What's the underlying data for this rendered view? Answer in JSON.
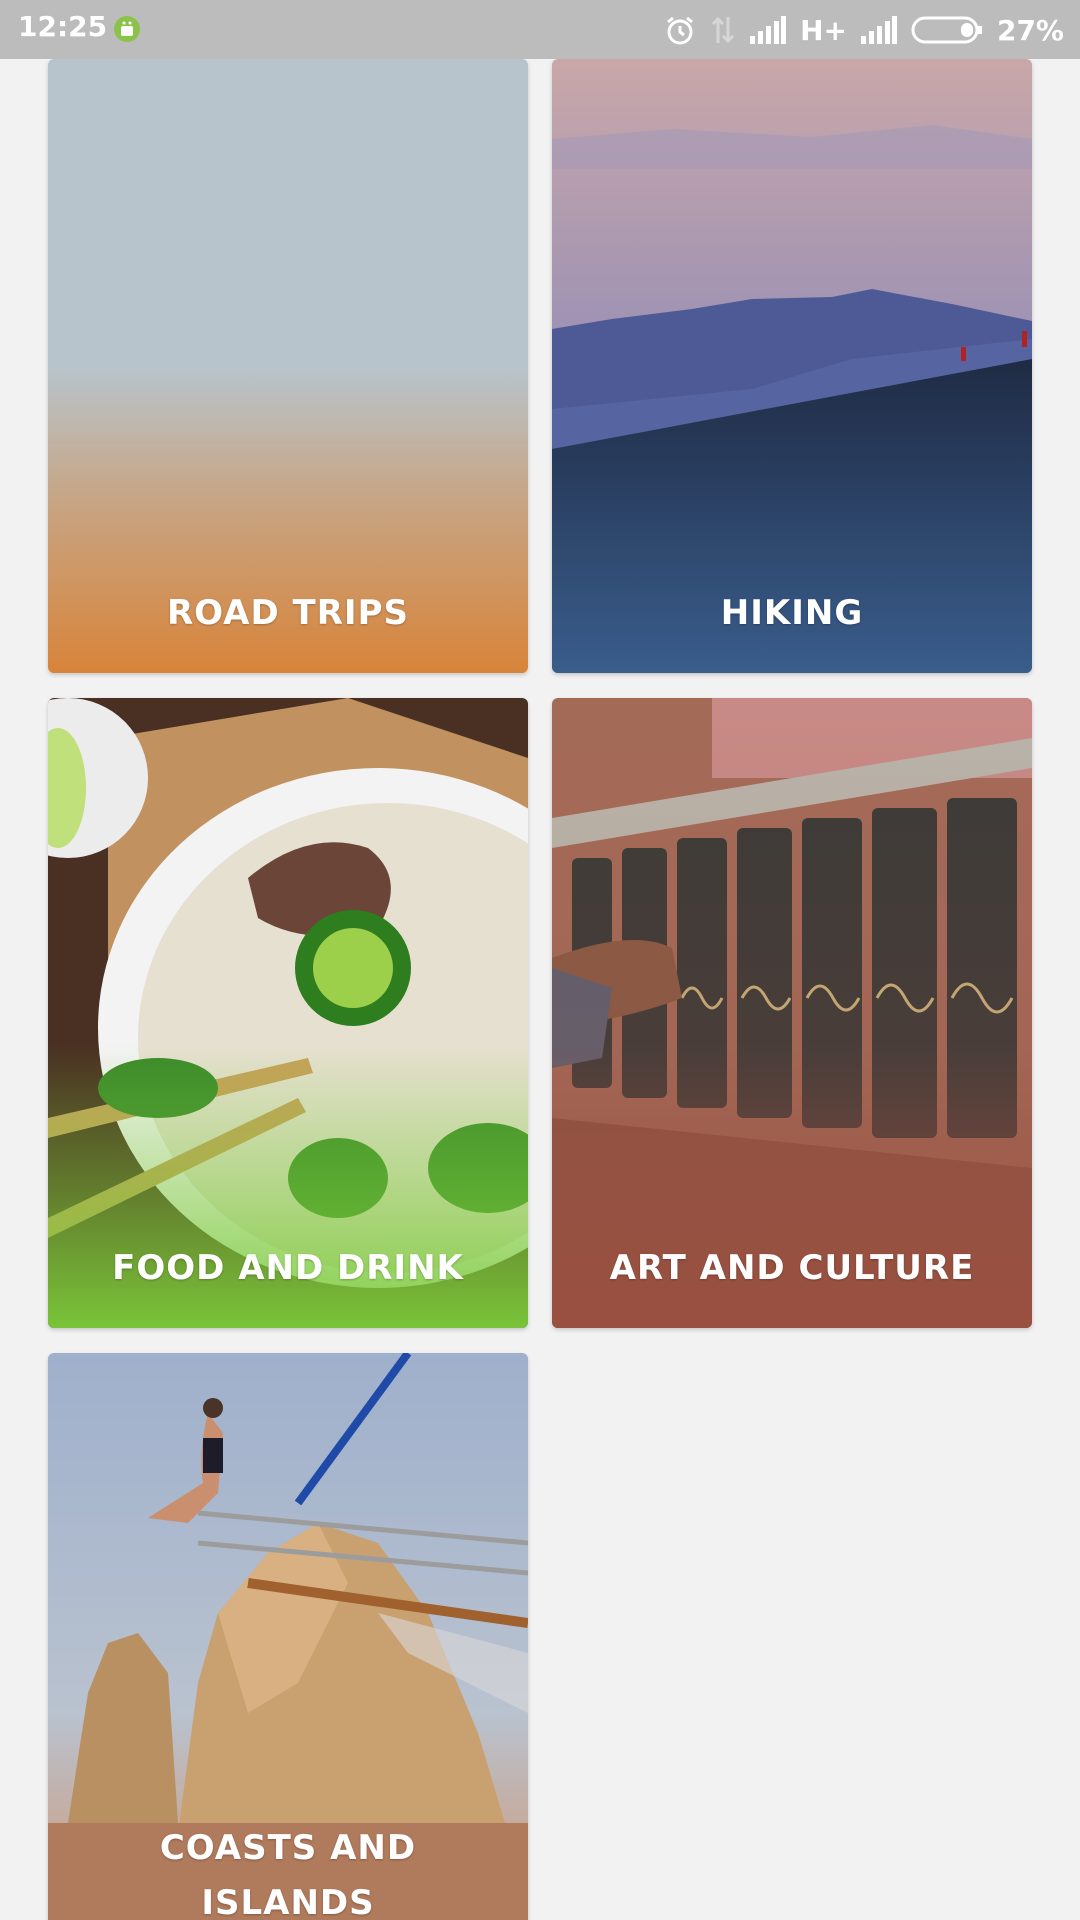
{
  "status_bar": {
    "time": "12:25",
    "network_type": "H+",
    "battery_percent": "27%",
    "icons": [
      "android-notification-icon",
      "alarm-icon",
      "data-transfer-icon",
      "signal-icon",
      "signal-icon",
      "battery-icon"
    ]
  },
  "categories": [
    {
      "label": "ROAD TRIPS",
      "overlay_color": "#d4853b"
    },
    {
      "label": "HIKING",
      "overlay_color": "#375c8c"
    },
    {
      "label": "FOOD AND DRINK",
      "overlay_color": "#7ccc3a"
    },
    {
      "label": "ART AND CULTURE",
      "overlay_color": "#9b5040"
    },
    {
      "label": "COASTS AND ISLANDS",
      "overlay_color": "#b87a5a"
    }
  ]
}
